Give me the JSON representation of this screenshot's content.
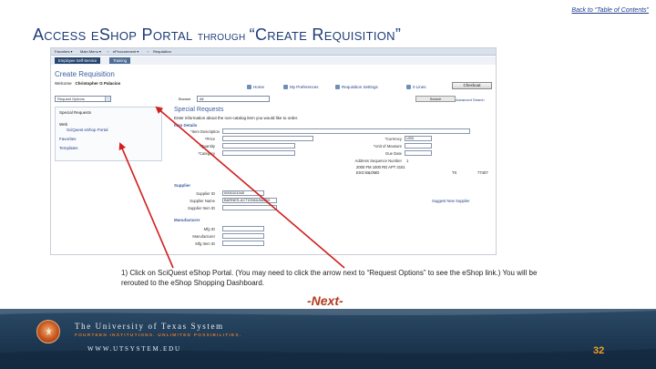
{
  "header": {
    "back_link": "Back to “Table of Contents”",
    "title_part1": "Access ",
    "title_part2": "eShop Portal ",
    "title_part3": "through ",
    "title_part4": "“Create Requisition”"
  },
  "screenshot": {
    "menubar": [
      "Favorites ▾",
      "Main Menu ▾",
      "›",
      "eProcurement ▾",
      "›",
      "Requisition"
    ],
    "tabs": [
      "Employee Self-Service",
      "Training"
    ],
    "page_title": "Create Requisition",
    "welcome_label": "Welcome",
    "welcome_name": "Christopher G Palacios",
    "toolbar": [
      "Home",
      "My Preferences",
      "Requisition Settings",
      "0 Lines"
    ],
    "checkout_label": "Checkout",
    "request_options_value": "Request Options",
    "search_scope_label": "Browse",
    "search_scope_value": "All",
    "search_button": "Search",
    "keyword_search": "Advanced Search",
    "left_panel": {
      "heading": "Special Requests",
      "items": [
        "Web",
        "SciQuest eShop Portal"
      ],
      "favorites": "Favorites",
      "templates": "Templates"
    },
    "special_requests_title": "Special Requests",
    "special_requests_note": "Enter information about the non-catalog item you would like to order.",
    "item_details_label": "Item Details",
    "fields": {
      "item_description": "*Item Description",
      "price": "*Price",
      "quantity": "*Quantity",
      "category": "*Category",
      "currency": "*Currency",
      "currency_value": "USD",
      "unit_of_measure": "*Unit of Measure",
      "due_date": "Due Date",
      "address_seq": "Address Sequence Number",
      "address_seq_value": "1",
      "address_line1": "2000 FM 1000 RD APT 3101",
      "address_line2": "ESO B&OMD",
      "address_state": "TX",
      "address_zip": "77407"
    },
    "supplier_label": "Supplier",
    "supplier_id_label": "Supplier ID",
    "supplier_id_value": "0000101040",
    "supplier_name_label": "Supplier Name",
    "supplier_name_value": "BARNES-ACTIONNUMARD",
    "supplier_item_label": "Supplier Item ID",
    "suggest_supplier": "Suggest New Supplier",
    "manufacturer_label": "Manufacturer",
    "mfg_id_label": "Mfg ID",
    "manufacturer_field_label": "Manufacturer",
    "mfg_item_label": "Mfg Item ID"
  },
  "instruction": "1) Click on SciQuest eShop Portal.  (You may need to click the arrow next to “Request Options” to see the eShop link.)  You will be rerouted to the eShop Shopping Dashboard.",
  "next_label": "-Next-",
  "footer": {
    "university": "The University of Texas System",
    "tagline": "FOURTEEN INSTITUTIONS. UNLIMITED POSSIBILITIES.",
    "url": "WWW.UTSYSTEM.EDU",
    "page_number": "32"
  },
  "colors": {
    "title": "#1e3c78",
    "arrow": "#d21e1e",
    "next": "#b33c1f",
    "footer_bg": "#1c3650",
    "page_number": "#f0a020"
  }
}
